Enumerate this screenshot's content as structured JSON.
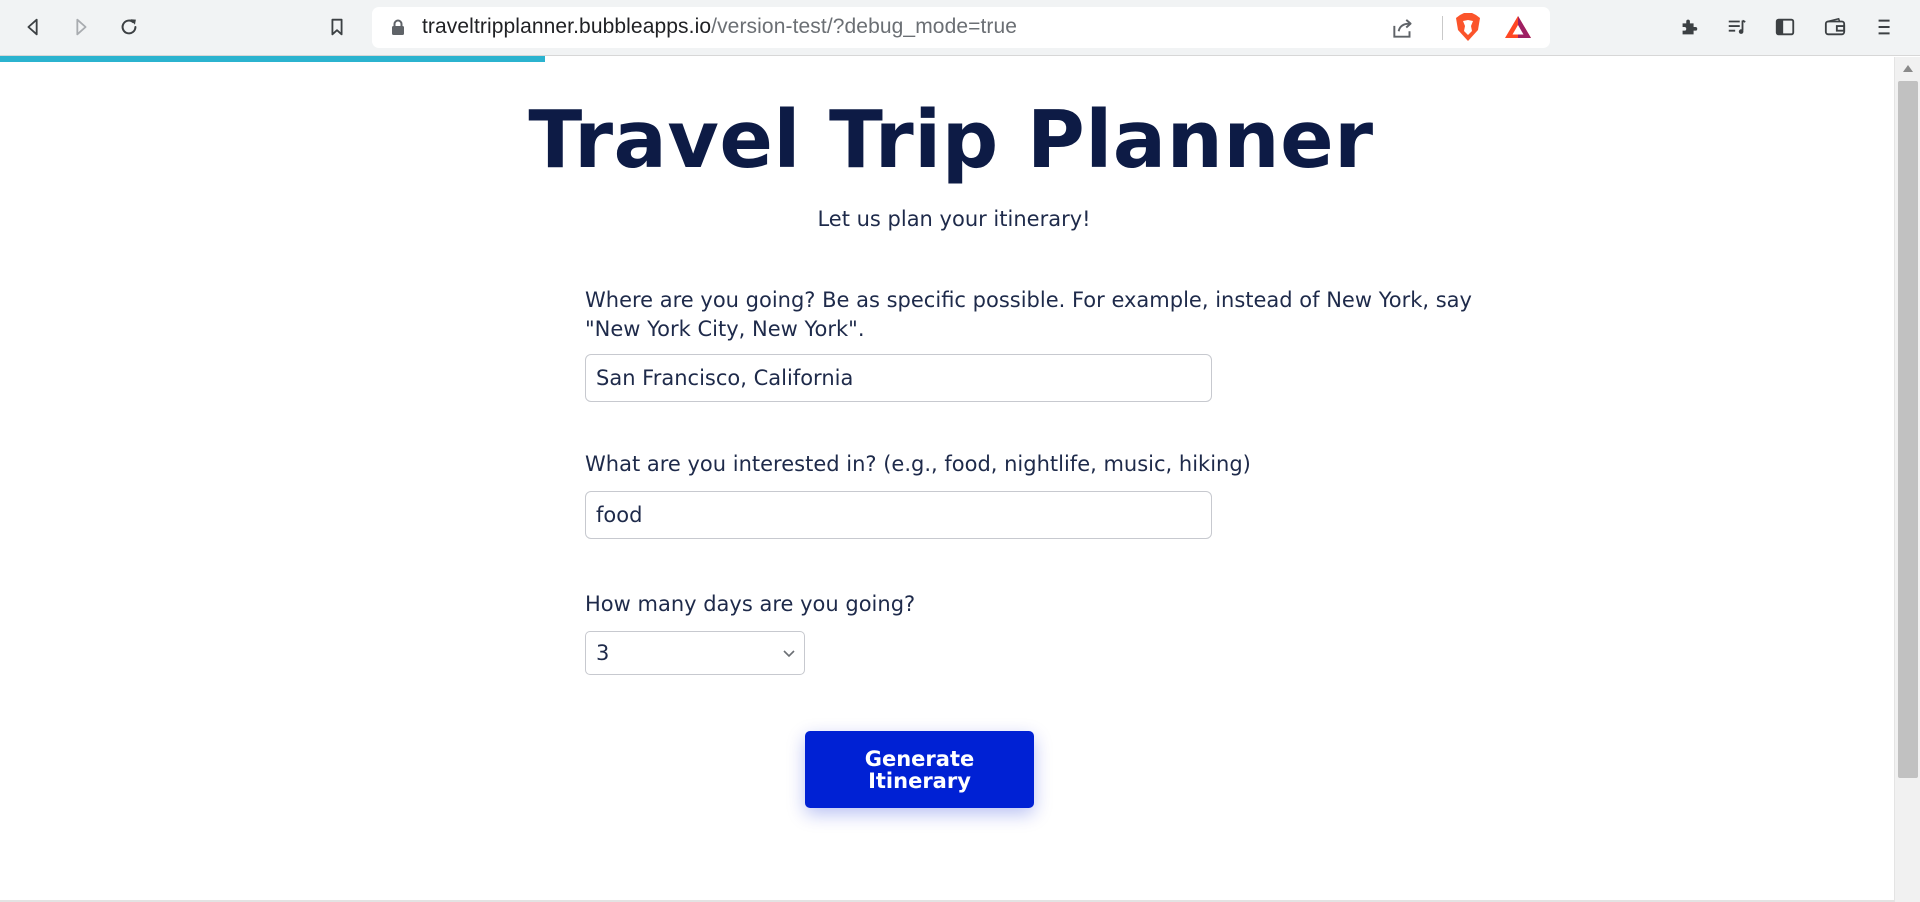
{
  "browser": {
    "url_domain": "traveltripplanner.bubbleapps.io",
    "url_path": "/version-test/?debug_mode=true",
    "icons": {
      "back": "back-icon",
      "forward": "forward-icon",
      "reload": "reload-icon",
      "bookmark": "bookmark-icon",
      "lock": "lock-icon",
      "share": "share-icon",
      "brave": "brave-shield-icon",
      "rewards": "brave-rewards-icon",
      "extensions": "extensions-icon",
      "playlist": "playlist-icon",
      "sidebar": "sidebar-icon",
      "wallet": "wallet-icon",
      "menu": "menu-icon"
    },
    "accent_color": "#2bb3cf"
  },
  "page": {
    "title": "Travel Trip Planner",
    "subtitle": "Let us plan your itinerary!",
    "destination": {
      "label": "Where are you going? Be as specific possible. For example, instead of New York, say \"New York City, New York\".",
      "value": "San Francisco, California"
    },
    "interests": {
      "label": "What are you interested in? (e.g., food, nightlife, music, hiking)",
      "value": "food"
    },
    "days": {
      "label": "How many days are you going?",
      "selected": "3"
    },
    "generate_button": "Generate Itinerary",
    "colors": {
      "title": "#0d1b45",
      "button": "#0021d4"
    }
  }
}
